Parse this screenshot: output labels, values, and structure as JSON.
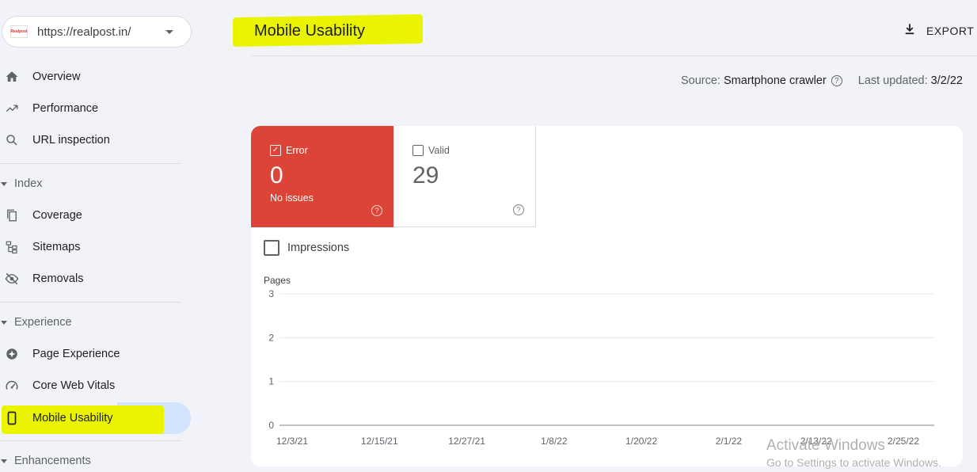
{
  "property": {
    "url": "https://realpost.in/",
    "favicon_text": "Realpost"
  },
  "nav": {
    "overview": "Overview",
    "performance": "Performance",
    "url_inspection": "URL inspection",
    "index_header": "Index",
    "coverage": "Coverage",
    "sitemaps": "Sitemaps",
    "removals": "Removals",
    "experience_header": "Experience",
    "page_experience": "Page Experience",
    "core_web_vitals": "Core Web Vitals",
    "mobile_usability": "Mobile Usability",
    "enhancements_header": "Enhancements"
  },
  "header": {
    "title": "Mobile Usability",
    "export_label": "EXPORT"
  },
  "meta": {
    "source_label": "Source:",
    "source_value": "Smartphone crawler",
    "updated_label": "Last updated:",
    "updated_value": "3/2/22"
  },
  "tiles": {
    "error": {
      "label": "Error",
      "count": "0",
      "sub": "No issues",
      "checked": true
    },
    "valid": {
      "label": "Valid",
      "count": "29",
      "checked": false
    }
  },
  "impressions_label": "Impressions",
  "chart_data": {
    "type": "line",
    "ylabel": "Pages",
    "yticks": [
      0,
      1,
      2,
      3
    ],
    "ylim": [
      0,
      3
    ],
    "x": [
      "12/3/21",
      "12/15/21",
      "12/27/21",
      "1/8/22",
      "1/20/22",
      "2/1/22",
      "2/13/22",
      "2/25/22"
    ],
    "series": [],
    "grid": true
  },
  "colors": {
    "error": "#db4437",
    "highlight": "#eaf400",
    "active_nav": "#d2e3fc"
  },
  "watermark": {
    "line1": "Activate Windows",
    "line2": "Go to Settings to activate Windows."
  }
}
